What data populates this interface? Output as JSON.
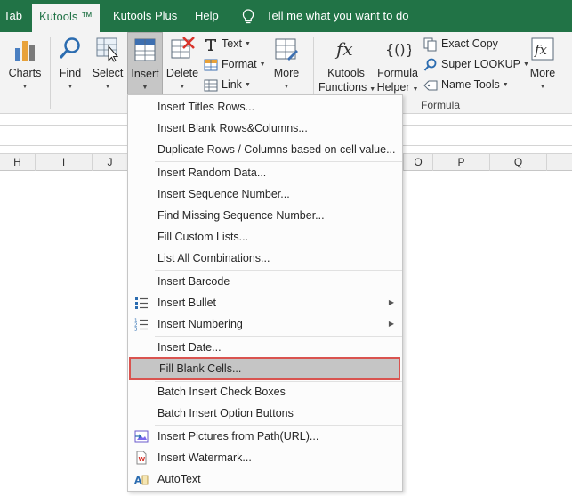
{
  "tabs": {
    "tab_partial": "Tab",
    "kutools": "Kutools ™",
    "kutools_plus": "Kutools Plus",
    "help": "Help",
    "tell_me": "Tell me what you want to do"
  },
  "ribbon": {
    "charts": "Charts",
    "find": "Find",
    "select": "Select",
    "insert": "Insert",
    "delete": "Delete",
    "text": "Text",
    "format": "Format",
    "link": "Link",
    "more1": "More",
    "kutools_functions_1": "Kutools",
    "kutools_functions_2": "Functions",
    "formula_helper_1": "Formula",
    "formula_helper_2": "Helper",
    "exact_copy": "Exact Copy",
    "super_lookup": "Super LOOKUP",
    "name_tools": "Name Tools",
    "more2": "More",
    "formula_group": "Formula"
  },
  "columns": [
    "H",
    "I",
    "J",
    "O",
    "P",
    "Q"
  ],
  "menu": {
    "items": [
      {
        "label": "Insert Titles Rows..."
      },
      {
        "label": "Insert Blank Rows&Columns..."
      },
      {
        "label": "Duplicate Rows / Columns based on cell value..."
      },
      {
        "label": "Insert Random Data..."
      },
      {
        "label": "Insert Sequence Number..."
      },
      {
        "label": "Find Missing Sequence Number..."
      },
      {
        "label": "Fill Custom Lists..."
      },
      {
        "label": "List All Combinations..."
      },
      {
        "label": "Insert Barcode"
      },
      {
        "label": "Insert Bullet"
      },
      {
        "label": "Insert Numbering"
      },
      {
        "label": "Insert Date..."
      },
      {
        "label": "Fill Blank Cells..."
      },
      {
        "label": "Batch Insert Check Boxes"
      },
      {
        "label": "Batch Insert Option Buttons"
      },
      {
        "label": "Insert Pictures from Path(URL)..."
      },
      {
        "label": "Insert Watermark..."
      },
      {
        "label": "AutoText"
      }
    ]
  },
  "colors": {
    "tab_green": "#217346",
    "highlight_border": "#d9534f",
    "highlight_fill": "#c5c5c5"
  }
}
